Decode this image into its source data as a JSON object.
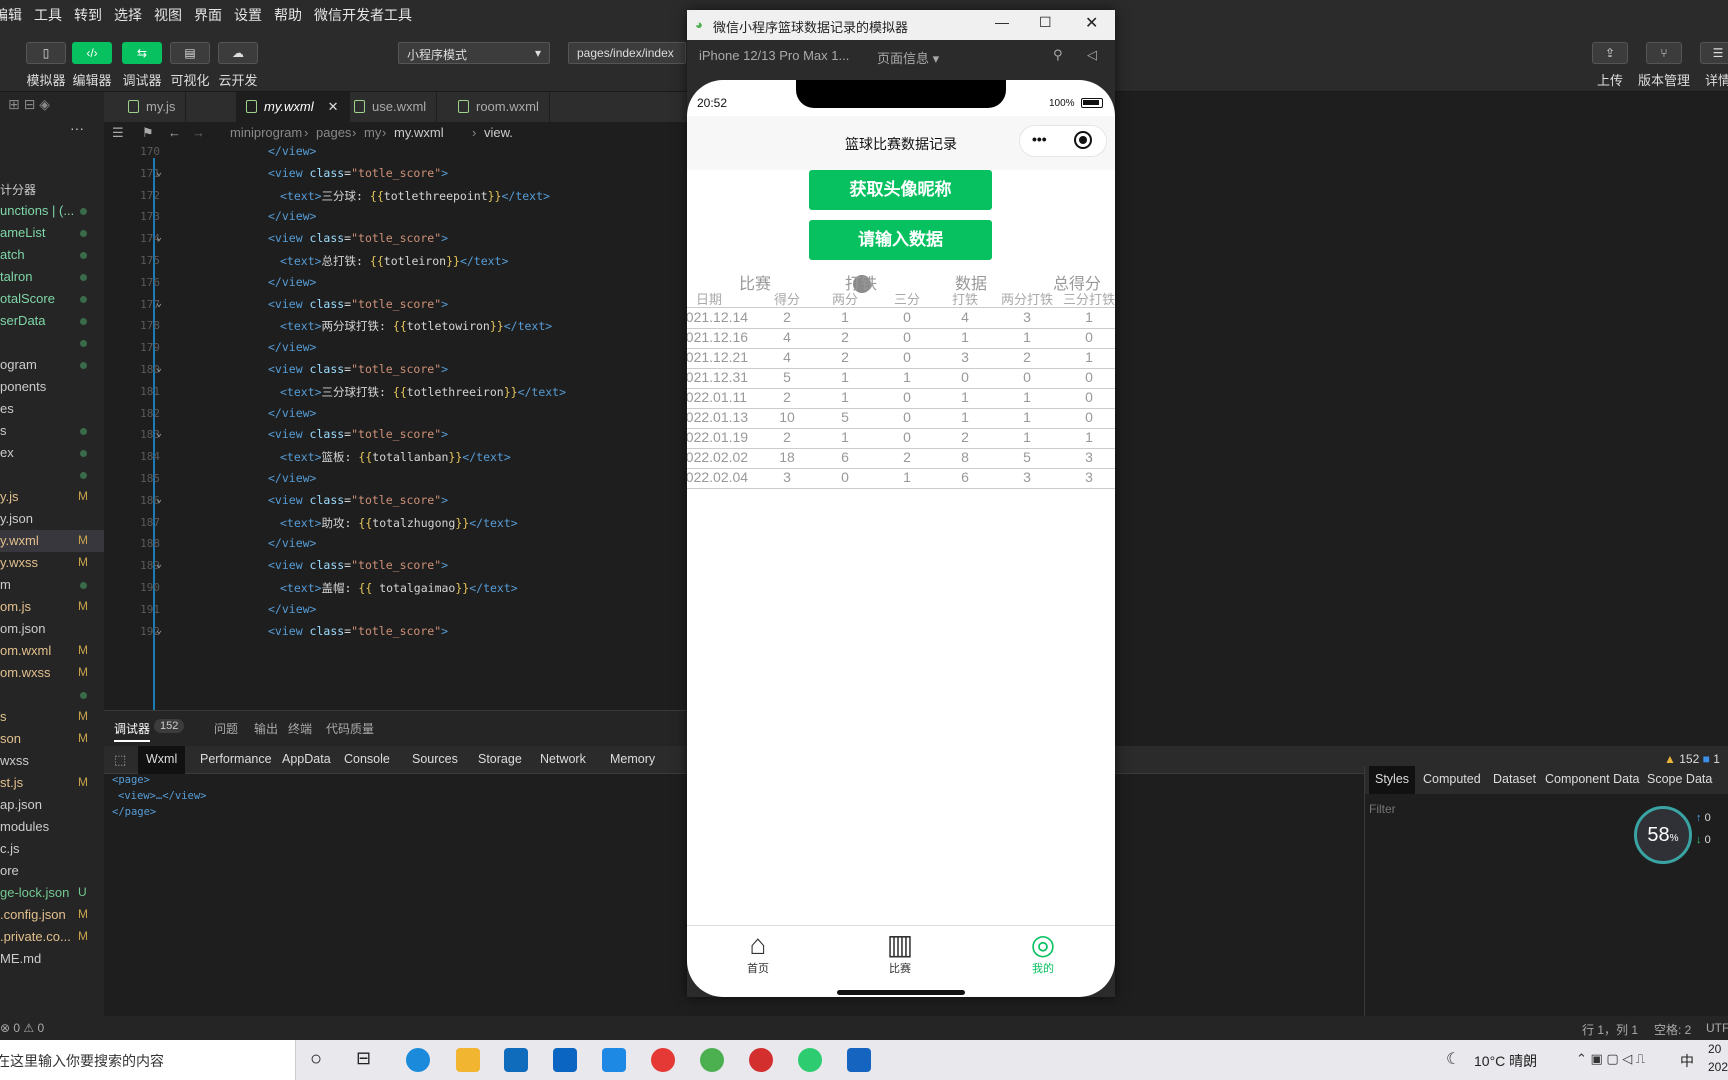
{
  "menu": [
    "编辑",
    "工具",
    "转到",
    "选择",
    "视图",
    "界面",
    "设置",
    "帮助",
    "微信开发者工具"
  ],
  "toolbar": {
    "buttons": [
      {
        "label": "模拟器",
        "icon": "phone-icon"
      },
      {
        "label": "编辑器",
        "icon": "code-icon"
      },
      {
        "label": "调试器",
        "icon": "debug-icon"
      },
      {
        "label": "可视化",
        "icon": "layout-icon"
      },
      {
        "label": "云开发",
        "icon": "cloud-icon"
      }
    ],
    "mode": "小程序模式",
    "path": "pages/index/index",
    "right": [
      "上传",
      "版本管理",
      "详情"
    ]
  },
  "sidebar": [
    {
      "text": "计分器",
      "status": ""
    },
    {
      "text": "unctions | (...",
      "status": "dot"
    },
    {
      "text": "ameList",
      "status": "dot"
    },
    {
      "text": "atch",
      "status": "dot"
    },
    {
      "text": "talron",
      "status": "dot"
    },
    {
      "text": "otalScore",
      "status": "dot"
    },
    {
      "text": "serData",
      "status": "dot"
    },
    {
      "text": "",
      "status": "dot"
    },
    {
      "text": "ogram",
      "status": "dot"
    },
    {
      "text": "ponents",
      "status": ""
    },
    {
      "text": "es",
      "status": ""
    },
    {
      "text": "s",
      "status": "dot"
    },
    {
      "text": "ex",
      "status": "dot"
    },
    {
      "text": "",
      "status": "dot"
    },
    {
      "text": "y.js",
      "status": "M"
    },
    {
      "text": "y.json",
      "status": ""
    },
    {
      "text": "y.wxml",
      "status": "M"
    },
    {
      "text": "y.wxss",
      "status": "M"
    },
    {
      "text": "m",
      "status": "dot"
    },
    {
      "text": "om.js",
      "status": "M"
    },
    {
      "text": "om.json",
      "status": ""
    },
    {
      "text": "om.wxml",
      "status": "M"
    },
    {
      "text": "om.wxss",
      "status": "M"
    },
    {
      "text": "",
      "status": "dot"
    },
    {
      "text": "s",
      "status": "M"
    },
    {
      "text": "son",
      "status": "M"
    },
    {
      "text": "wxss",
      "status": ""
    },
    {
      "text": "st.js",
      "status": "M"
    },
    {
      "text": "ap.json",
      "status": ""
    },
    {
      "text": "modules",
      "status": ""
    },
    {
      "text": "c.js",
      "status": ""
    },
    {
      "text": "ore",
      "status": ""
    },
    {
      "text": "ge-lock.json",
      "status": "U"
    },
    {
      "text": ".config.json",
      "status": "M"
    },
    {
      "text": ".private.co...",
      "status": "M"
    },
    {
      "text": "ME.md",
      "status": ""
    }
  ],
  "tabs": [
    {
      "label": "my.js",
      "active": false
    },
    {
      "label": "my.wxml",
      "active": true
    },
    {
      "label": "use.wxml",
      "active": false
    },
    {
      "label": "room.wxml",
      "active": false
    }
  ],
  "breadcrumb": [
    "miniprogram",
    "pages",
    "my",
    "my.wxml",
    "view."
  ],
  "code_lines": [
    {
      "n": "170",
      "i": 0,
      "kind": "close"
    },
    {
      "n": "171",
      "i": 0,
      "kind": "open",
      "cls": "totle_score"
    },
    {
      "n": "172",
      "i": 1,
      "kind": "text",
      "label": "三分球: ",
      "var": "totlethreepoint"
    },
    {
      "n": "173",
      "i": 0,
      "kind": "close"
    },
    {
      "n": "174",
      "i": 0,
      "kind": "open",
      "cls": "totle_score"
    },
    {
      "n": "175",
      "i": 1,
      "kind": "text",
      "label": "总打铁: ",
      "var": "totleiron"
    },
    {
      "n": "176",
      "i": 0,
      "kind": "close"
    },
    {
      "n": "177",
      "i": 0,
      "kind": "open",
      "cls": "totle_score"
    },
    {
      "n": "178",
      "i": 1,
      "kind": "text",
      "label": "两分球打铁: ",
      "var": "totletowiron"
    },
    {
      "n": "179",
      "i": 0,
      "kind": "close"
    },
    {
      "n": "180",
      "i": 0,
      "kind": "open",
      "cls": "totle_score"
    },
    {
      "n": "181",
      "i": 1,
      "kind": "text",
      "label": "三分球打铁: ",
      "var": "totlethreeiron"
    },
    {
      "n": "182",
      "i": 0,
      "kind": "close"
    },
    {
      "n": "183",
      "i": 0,
      "kind": "open",
      "cls": "totle_score"
    },
    {
      "n": "184",
      "i": 1,
      "kind": "text",
      "label": "篮板: ",
      "var": "totallanban"
    },
    {
      "n": "185",
      "i": 0,
      "kind": "close"
    },
    {
      "n": "186",
      "i": 0,
      "kind": "open",
      "cls": "totle_score"
    },
    {
      "n": "187",
      "i": 1,
      "kind": "text",
      "label": "助攻: ",
      "var": "totalzhugong"
    },
    {
      "n": "188",
      "i": 0,
      "kind": "close"
    },
    {
      "n": "189",
      "i": 0,
      "kind": "open",
      "cls": "totle_score"
    },
    {
      "n": "190",
      "i": 1,
      "kind": "text",
      "label": "盖帽: ",
      "var": " totalgaimao"
    },
    {
      "n": "191",
      "i": 0,
      "kind": "close"
    },
    {
      "n": "192",
      "i": 0,
      "kind": "open",
      "cls": "totle_score"
    }
  ],
  "debugger": {
    "title": "调试器",
    "badge": "152",
    "head_tabs": [
      "问题",
      "输出",
      "终端",
      "代码质量"
    ],
    "tabs": [
      "Wxml",
      "Performance",
      "AppData",
      "Console",
      "Sources",
      "Storage",
      "Network",
      "Memory"
    ],
    "tree": [
      "<page>",
      "<view>…</view>",
      "</page>"
    ],
    "warnings": "152",
    "errors": "1",
    "style_tabs": [
      "Styles",
      "Computed",
      "Dataset",
      "Component Data",
      "Scope Data"
    ],
    "filter_placeholder": "Filter",
    "perf": "58",
    "perf_unit": "%",
    "perf_up": "0",
    "perf_down": "0"
  },
  "statusbar": {
    "left": "0 ⚠ 0",
    "pos": "行 1，列 1",
    "space": "空格: 2",
    "enc": "UTF-"
  },
  "simulator": {
    "title": "微信小程序篮球数据记录的模拟器",
    "device": "iPhone 12/13 Pro Max 1...",
    "page_info": "页面信息",
    "time": "20:52",
    "battery": "100%",
    "nav_title": "篮球比赛数据记录",
    "btn_avatar": "获取头像昵称",
    "btn_input": "请输入数据",
    "group_headers": [
      "比赛",
      "打铁",
      "数据",
      "总得分"
    ],
    "columns": [
      "日期",
      "得分",
      "两分",
      "三分",
      "打铁",
      "两分打铁",
      "三分打铁"
    ],
    "rows": [
      [
        "2021.12.14",
        "2",
        "1",
        "0",
        "4",
        "3",
        "1"
      ],
      [
        "2021.12.16",
        "4",
        "2",
        "0",
        "1",
        "1",
        "0"
      ],
      [
        "2021.12.21",
        "4",
        "2",
        "0",
        "3",
        "2",
        "1"
      ],
      [
        "2021.12.31",
        "5",
        "1",
        "1",
        "0",
        "0",
        "0"
      ],
      [
        "2022.01.11",
        "2",
        "1",
        "0",
        "1",
        "1",
        "0"
      ],
      [
        "2022.01.13",
        "10",
        "5",
        "0",
        "1",
        "1",
        "0"
      ],
      [
        "2022.01.19",
        "2",
        "1",
        "0",
        "2",
        "1",
        "1"
      ],
      [
        "2022.02.02",
        "18",
        "6",
        "2",
        "8",
        "5",
        "3"
      ],
      [
        "2022.02.04",
        "3",
        "0",
        "1",
        "6",
        "3",
        "3"
      ]
    ],
    "tabbar": [
      {
        "label": "首页",
        "icon": "home-icon",
        "active": false
      },
      {
        "label": "比赛",
        "icon": "chart-icon",
        "active": false
      },
      {
        "label": "我的",
        "icon": "user-icon",
        "active": true
      }
    ],
    "accent": "#07c160"
  },
  "taskbar": {
    "search_placeholder": "在这里输入你要搜索的内容",
    "weather": "10°C 晴朗",
    "ime": "中",
    "clock_top": "20",
    "clock_bottom": "202"
  }
}
